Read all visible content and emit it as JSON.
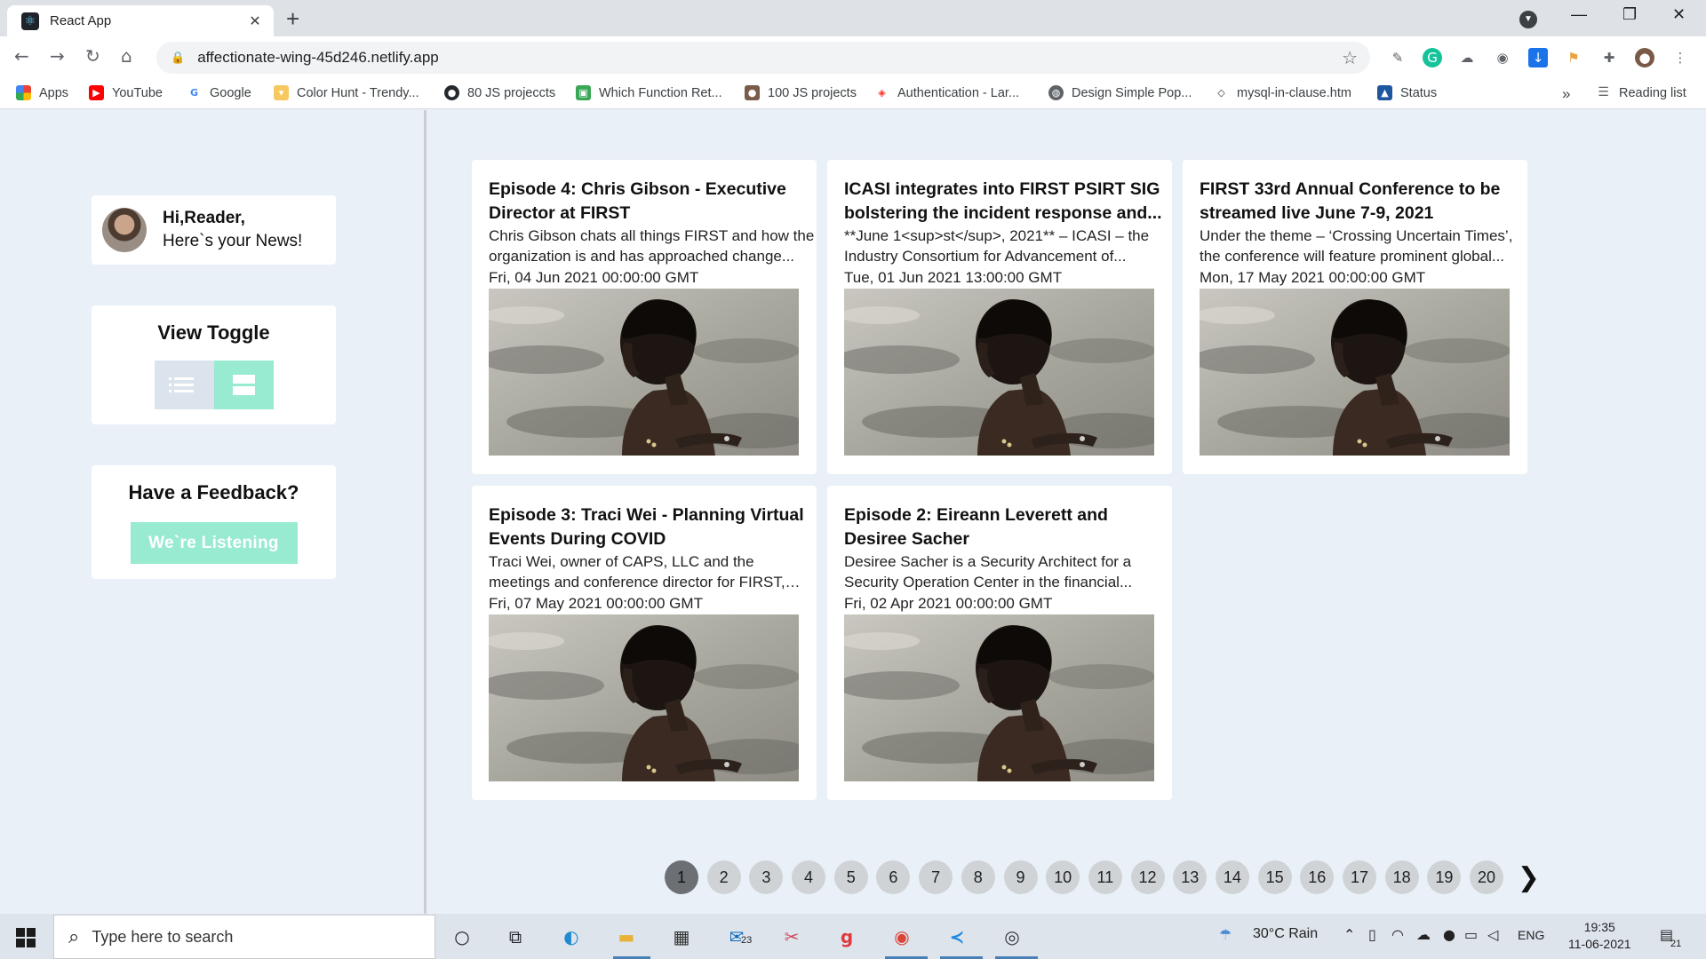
{
  "browser": {
    "tab_title": "React App",
    "url": "affectionate-wing-45d246.netlify.app",
    "bookmarks": [
      {
        "label": "Apps",
        "icon": "apps-grid-icon"
      },
      {
        "label": "YouTube",
        "icon": "youtube-icon"
      },
      {
        "label": "Google",
        "icon": "google-icon"
      },
      {
        "label": "Color Hunt - Trendy...",
        "icon": "color-hunt-icon"
      },
      {
        "label": "80 JS projeccts",
        "icon": "github-icon"
      },
      {
        "label": "Which Function Ret...",
        "icon": "site-icon"
      },
      {
        "label": "100 JS projects",
        "icon": "avatar-icon"
      },
      {
        "label": "Authentication - Lar...",
        "icon": "laravel-icon"
      },
      {
        "label": "Design Simple Pop...",
        "icon": "globe-icon"
      },
      {
        "label": "mysql-in-clause.htm",
        "icon": "diamond-icon"
      },
      {
        "label": "Status",
        "icon": "status-icon"
      }
    ],
    "more_bookmarks": "»",
    "reading_list": "Reading list"
  },
  "sidebar": {
    "greeting_line1": "Hi,Reader,",
    "greeting_line2": "Here`s your News!",
    "toggle_title": "View Toggle",
    "feedback_title": "Have a Feedback?",
    "feedback_button": "We`re Listening"
  },
  "news": [
    {
      "title": "Episode 4: Chris Gibson - Executive Director at FIRST",
      "description": "Chris Gibson chats all things FIRST and how the organization is and has approached change...",
      "date": "Fri, 04 Jun 2021 00:00:00 GMT"
    },
    {
      "title": "ICASI integrates into FIRST PSIRT SIG bolstering the incident response and...",
      "description": "**June 1<sup>st</sup>, 2021** – ICASI – the Industry Consortium for Advancement of...",
      "date": "Tue, 01 Jun 2021 13:00:00 GMT"
    },
    {
      "title": "FIRST 33rd Annual Conference to be streamed live June 7-9, 2021",
      "description": "Under the theme – ‘Crossing Uncertain Times’, the conference will feature prominent global...",
      "date": "Mon, 17 May 2021 00:00:00 GMT"
    },
    {
      "title": "Episode 3: Traci Wei - Planning Virtual Events During COVID",
      "description": "Traci Wei, owner of CAPS, LLC and the meetings and conference director for FIRST, shares her...",
      "date": "Fri, 07 May 2021 00:00:00 GMT"
    },
    {
      "title": "Episode 2: Eireann Leverett and Desiree Sacher",
      "description": "Desiree Sacher is a Security Architect for a Security Operation Center in the financial...",
      "date": "Fri, 02 Apr 2021 00:00:00 GMT"
    }
  ],
  "pagination": {
    "pages": [
      "1",
      "2",
      "3",
      "4",
      "5",
      "6",
      "7",
      "8",
      "9",
      "10",
      "11",
      "12",
      "13",
      "14",
      "15",
      "16",
      "17",
      "18",
      "19",
      "20"
    ],
    "active": "1",
    "next": "❯"
  },
  "taskbar": {
    "search_placeholder": "Type here to search",
    "mail_badge": "23",
    "weather": "30°C  Rain",
    "language": "ENG",
    "time": "19:35",
    "date": "11-06-2021",
    "notifications": "21"
  },
  "colors": {
    "accent": "#98ead0",
    "page_bg": "#e9f0f7",
    "active_page": "#6c7075"
  }
}
